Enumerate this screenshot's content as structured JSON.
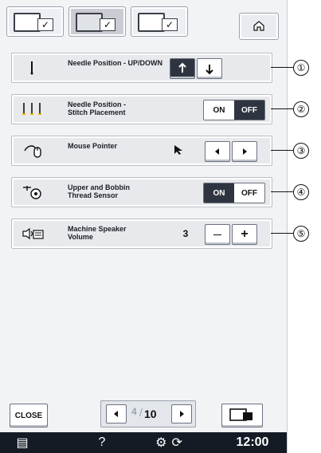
{
  "tabs": [
    {
      "name": "tab-1",
      "active": false
    },
    {
      "name": "tab-2",
      "active": true
    },
    {
      "name": "tab-3",
      "active": false
    }
  ],
  "rows": [
    {
      "id": 1,
      "label": "Needle Position - UP/DOWN",
      "callout": "①"
    },
    {
      "id": 2,
      "label": "Needle Position -\nStitch Placement",
      "callout": "②",
      "toggle": {
        "on": "ON",
        "off": "OFF",
        "active": "OFF"
      }
    },
    {
      "id": 3,
      "label": "Mouse Pointer",
      "callout": "③"
    },
    {
      "id": 4,
      "label": "Upper and Bobbin\nThread Sensor",
      "callout": "④",
      "toggle": {
        "on": "ON",
        "off": "OFF",
        "active": "ON"
      }
    },
    {
      "id": 5,
      "label": "Machine Speaker\nVolume",
      "callout": "⑤",
      "value": "3"
    }
  ],
  "footer": {
    "close_label": "CLOSE",
    "page_current": "4",
    "page_total": "10",
    "time": "12:00",
    "help": "?"
  },
  "icons": {
    "home": "home-icon",
    "needle": "needle-icon",
    "mouse": "mouse-icon",
    "sensor": "thread-sensor-icon",
    "speaker": "speaker-icon",
    "prev": "prev-arrow-icon",
    "next": "next-arrow-icon",
    "doc": "document-icon",
    "settings": "settings-icon",
    "sync": "sync-icon",
    "image": "image-icon"
  }
}
